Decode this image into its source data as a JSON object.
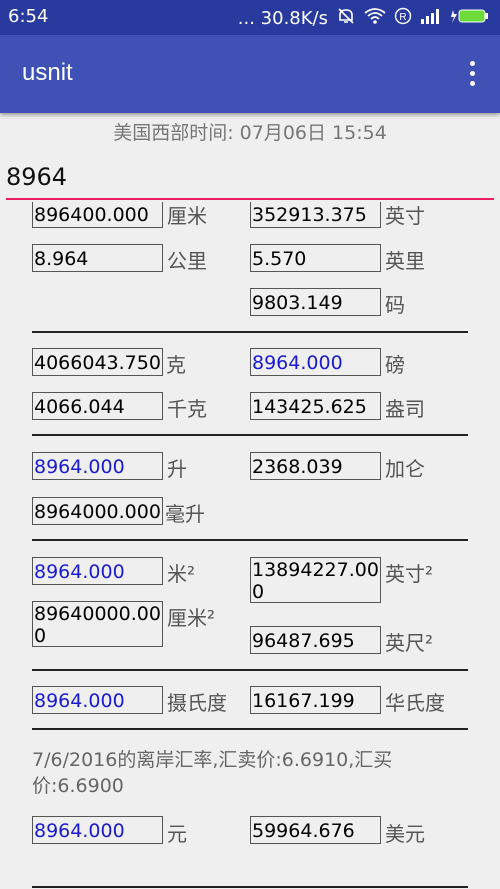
{
  "status_bar": {
    "time": "6:54",
    "network_speed": "... 30.8K/s",
    "icons": [
      "mute-icon",
      "wifi-icon",
      "registered-icon",
      "signal-icon",
      "battery-icon"
    ]
  },
  "app_bar": {
    "title": "usnit",
    "menu_icon": "overflow-menu-icon"
  },
  "timezone_label": "美国西部时间: 07月06日 15:54",
  "input_value": "8964",
  "length": {
    "cm_value": "896400.000",
    "cm_unit": "厘米",
    "inch_value": "352913.375",
    "inch_unit": "英寸",
    "km_value": "8.964",
    "km_unit": "公里",
    "mile_value": "5.570",
    "mile_unit": "英里",
    "yard_value": "9803.149",
    "yard_unit": "码"
  },
  "weight": {
    "g_value": "4066043.750",
    "g_unit": "克",
    "lb_value": "8964.000",
    "lb_unit": "磅",
    "kg_value": "4066.044",
    "kg_unit": "千克",
    "oz_value": "143425.625",
    "oz_unit": "盎司"
  },
  "volume": {
    "l_value": "8964.000",
    "l_unit": "升",
    "gal_value": "2368.039",
    "gal_unit": "加仑",
    "ml_value": "8964000.000",
    "ml_unit": "毫升"
  },
  "area": {
    "m2_value": "8964.000",
    "m2_unit": "米²",
    "in2_value": "13894227.000",
    "in2_unit": "英寸²",
    "cm2_value": "89640000.000",
    "cm2_unit": "厘米²",
    "ft2_value": "96487.695",
    "ft2_unit": "英尺²"
  },
  "temperature": {
    "c_value": "8964.000",
    "c_unit": "摄氏度",
    "f_value": "16167.199",
    "f_unit": "华氏度"
  },
  "currency": {
    "note": "7/6/2016的离岸汇率,汇卖价:6.6910,汇买价:6.6900",
    "cny_value": "8964.000",
    "cny_unit": "元",
    "usd_value": "59964.676",
    "usd_unit": "美元"
  },
  "colors": {
    "status_bar": "#293a9f",
    "app_bar": "#3f51b5",
    "input_underline": "#e91e63",
    "active_value": "#1a1ad0"
  }
}
